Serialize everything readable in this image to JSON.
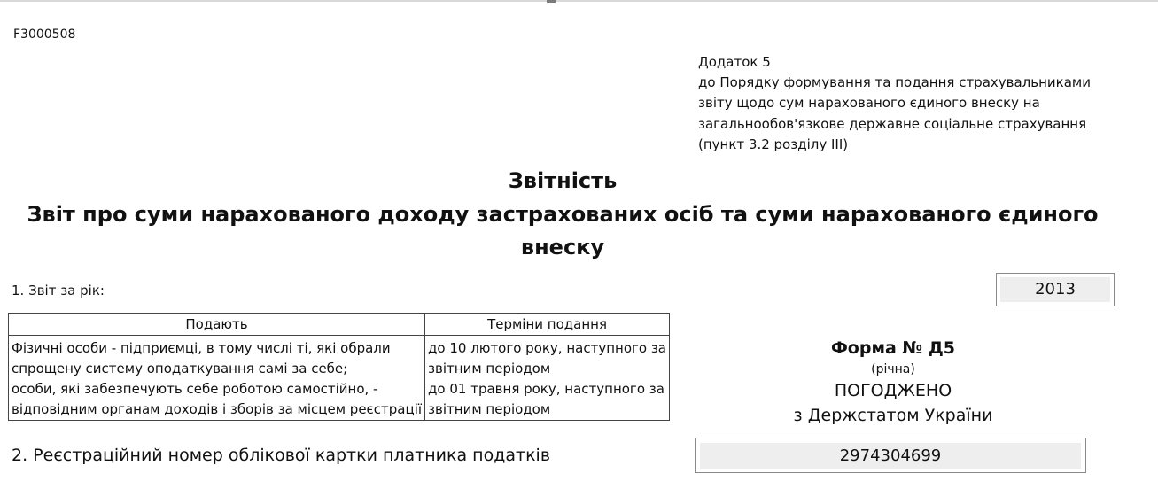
{
  "form_code": "F3000508",
  "appendix": {
    "lines": [
      "Додаток 5",
      "до Порядку формування та подання страхувальниками",
      "звіту щодо сум нарахованого єдиного внеску на",
      "загальнообов'язкове державне соціальне страхування",
      "(пункт 3.2 розділу III)"
    ]
  },
  "titles": {
    "heading": "Звітність",
    "subtitle_line1": "Звіт про суми нарахованого доходу застрахованих осіб та суми нарахованого єдиного",
    "subtitle_line2": "внеску"
  },
  "section1": {
    "label": "1. Звіт за рік:",
    "year": "2013"
  },
  "table": {
    "headers": [
      "Подають",
      "Терміни подання"
    ],
    "submitters_lines": [
      "Фізичні особи - підприємці, в тому числі ті, які обрали",
      "спрощену систему оподаткування самі за себе;",
      "особи, які забезпечують себе роботою самостійно, -",
      "відповідним органам доходів і зборів за місцем реєстрації"
    ],
    "deadlines_lines": [
      "до 10 лютого року, наступного за",
      "звітним періодом",
      "до 01 травня року, наступного за",
      "звітним періодом"
    ]
  },
  "form_info": {
    "number": "Форма № Д5",
    "annual": "(річна)",
    "agreed": "ПОГОДЖЕНО",
    "agreed_with": "з Держстатом України"
  },
  "section2": {
    "label": "2. Реєстраційний номер облікової картки платника податків",
    "value": "2974304699"
  }
}
